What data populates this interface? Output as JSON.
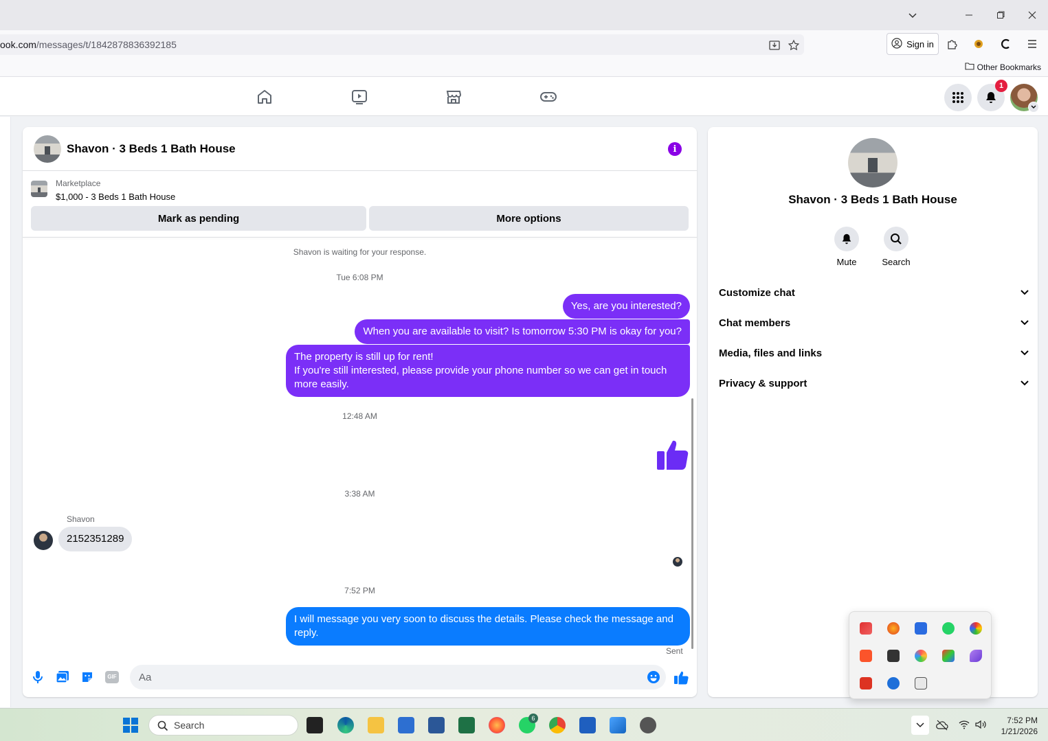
{
  "browser": {
    "url_host": "ook.com",
    "url_path": "/messages/t/1842878836392185",
    "sign_in_label": "Sign in",
    "other_bookmarks_label": "Other Bookmarks"
  },
  "fb_nav": {
    "notification_count": "1"
  },
  "chat": {
    "title": "Shavon · 3 Beds 1 Bath House",
    "marketplace_label": "Marketplace",
    "marketplace_item": "$1,000 - 3 Beds 1 Bath House",
    "mark_pending_label": "Mark as pending",
    "more_options_label": "More options",
    "waiting_text": "Shavon is waiting for your response.",
    "timestamps": [
      "Tue 6:08 PM",
      "12:48 AM",
      "3:38 AM",
      "7:52 PM"
    ],
    "messages": [
      "Yes, are you interested?",
      "When you are available to visit? Is tomorrow 5:30 PM is okay for you?",
      "The property is still up for rent!",
      "If you're still interested, please provide your phone number so we can get in touch more easily.",
      "2152351289",
      "I will message you very soon to discuss the details. Please check the message and reply."
    ],
    "sender_name": "Shavon",
    "sent_label": "Sent",
    "composer_placeholder": "Aa",
    "gif_label": "GIF"
  },
  "right_panel": {
    "name": "Shavon · 3 Beds 1 Bath House",
    "mute_label": "Mute",
    "search_label": "Search",
    "sections": [
      "Customize chat",
      "Chat members",
      "Media, files and links",
      "Privacy & support"
    ]
  },
  "taskbar": {
    "search_label": "Search",
    "whatsapp_badge": "6",
    "time": "7:52 PM",
    "date": "1/21/2026"
  },
  "colors": {
    "outgoing_purple": "#7b2ff7",
    "outgoing_blue": "#0a7cff",
    "accent_info": "#8a00e6",
    "badge_red": "#e41e3f"
  }
}
